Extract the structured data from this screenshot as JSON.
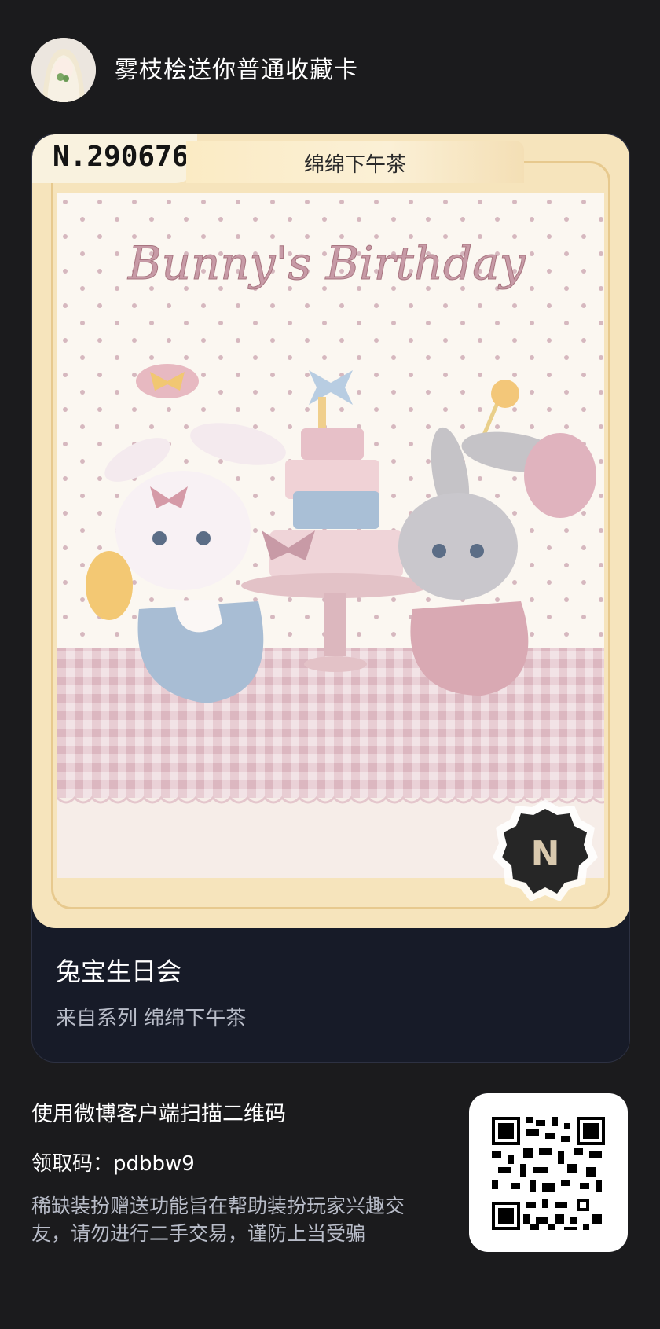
{
  "header": {
    "sender_text": "雾枝桧送你普通收藏卡"
  },
  "card": {
    "number": "N.290676",
    "series_tab": "绵绵下午茶",
    "art_caption": "Bunny's Birthday",
    "badge_letter": "N",
    "title": "兔宝生日会",
    "series_line": "来自系列 绵绵下午茶"
  },
  "footer": {
    "instruction": "使用微博客户端扫描二维码",
    "code_label": "领取码：",
    "code_value": "pdbbw9",
    "disclaimer": "稀缺装扮赠送功能旨在帮助装扮玩家兴趣交友，请勿进行二手交易，谨防上当受骗"
  },
  "colors": {
    "background": "#1b1b1d",
    "card_panel": "#171b28",
    "frame_gold": "#f6e4bc",
    "accent_pink": "#d9a9b3",
    "accent_blue": "#a9bfd6"
  },
  "icons": [
    "avatar",
    "rarity-badge-n-icon",
    "qr-code"
  ]
}
